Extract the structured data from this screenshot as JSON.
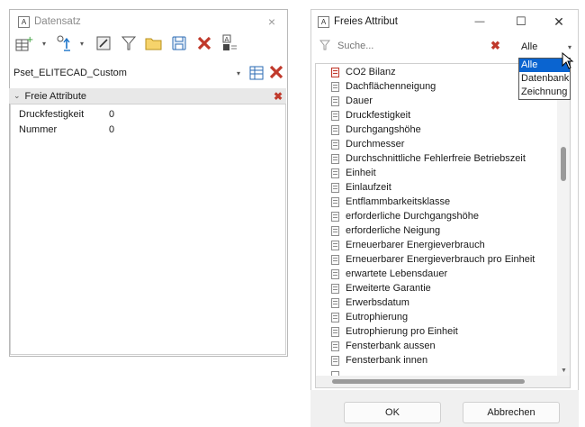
{
  "left_window": {
    "title": "Datensatz",
    "close_glyph": "×",
    "pset_value": "Pset_ELITECAD_Custom",
    "group_label": "Freie Attribute",
    "rows": [
      {
        "name": "Druckfestigkeit",
        "value": "0"
      },
      {
        "name": "Nummer",
        "value": "0"
      }
    ]
  },
  "right_window": {
    "title": "Freies Attribut",
    "minimize_glyph": "—",
    "maximize_glyph": "☐",
    "close_glyph": "✕",
    "search_placeholder": "Suche...",
    "filter_value": "Alle",
    "filter_options": [
      "Alle",
      "Datenbank",
      "Zeichnung"
    ],
    "items": [
      "CO2 Bilanz",
      "Dachflächenneigung",
      "Dauer",
      "Druckfestigkeit",
      "Durchgangshöhe",
      "Durchmesser",
      "Durchschnittliche Fehlerfreie Betriebszeit",
      "Einheit",
      "Einlaufzeit",
      "Entflammbarkeitsklasse",
      "erforderliche Durchgangshöhe",
      "erforderliche Neigung",
      "Erneuerbarer Energieverbrauch",
      "Erneuerbarer Energieverbrauch pro Einheit",
      "erwartete Lebensdauer",
      "Erweiterte Garantie",
      "Erwerbsdatum",
      "Eutrophierung",
      "Eutrophierung pro Einheit",
      "Fensterbank aussen",
      "Fensterbank innen"
    ],
    "ok_label": "OK",
    "cancel_label": "Abbrechen"
  },
  "colors": {
    "accent": "#0a64d0",
    "delete_red": "#c0392b",
    "group_bg": "#e8e8e8"
  }
}
